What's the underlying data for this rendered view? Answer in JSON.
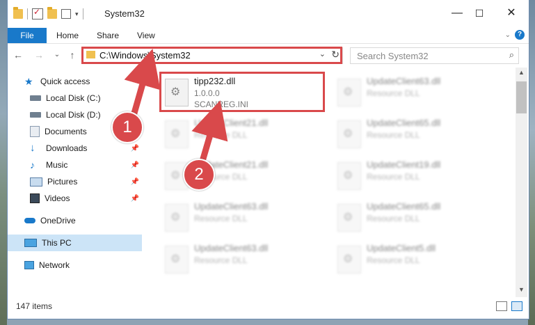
{
  "window": {
    "title": "System32",
    "controls": {
      "minimize": "—",
      "maximize": "☐",
      "close": "✕"
    }
  },
  "ribbon": {
    "tabs": [
      "File",
      "Home",
      "Share",
      "View"
    ],
    "expand_icon": "chevron-down-icon",
    "help_label": "?"
  },
  "nav": {
    "back": "←",
    "forward": "→",
    "dropdown": "⌄",
    "up": "↑",
    "address": "C:\\Windows\\System32",
    "search_placeholder": "Search System32"
  },
  "sidebar": {
    "items": [
      {
        "label": "Quick access",
        "icon": "star-icon",
        "pinned": false
      },
      {
        "label": "Local Disk (C:)",
        "icon": "drive-icon",
        "pinned": false
      },
      {
        "label": "Local Disk (D:)",
        "icon": "drive-icon",
        "pinned": false
      },
      {
        "label": "Documents",
        "icon": "documents-icon",
        "pinned": true
      },
      {
        "label": "Downloads",
        "icon": "download-icon",
        "pinned": true
      },
      {
        "label": "Music",
        "icon": "music-icon",
        "pinned": true
      },
      {
        "label": "Pictures",
        "icon": "pictures-icon",
        "pinned": true
      },
      {
        "label": "Videos",
        "icon": "videos-icon",
        "pinned": true
      },
      {
        "label": "OneDrive",
        "icon": "cloud-icon",
        "pinned": false
      },
      {
        "label": "This PC",
        "icon": "computer-icon",
        "pinned": false,
        "selected": true
      },
      {
        "label": "Network",
        "icon": "network-icon",
        "pinned": false
      }
    ]
  },
  "files": [
    {
      "name": "tipp232.dll",
      "line2": "1.0.0.0",
      "line3": "SCANREG.INI",
      "highlighted": true
    },
    {
      "name": "UpdateClient63.dll",
      "line2": "Resource DLL"
    },
    {
      "name": "UpdateClient21.dll",
      "line2": "Resource DLL"
    },
    {
      "name": "UpdateClient65.dll",
      "line2": "Resource DLL"
    },
    {
      "name": "UpdateClient21.dll",
      "line2": "Resource DLL"
    },
    {
      "name": "UpdateClient19.dll",
      "line2": "Resource DLL"
    },
    {
      "name": "UpdateClient63.dll",
      "line2": "Resource DLL"
    },
    {
      "name": "UpdateClient65.dll",
      "line2": "Resource DLL"
    },
    {
      "name": "UpdateClient63.dll",
      "line2": "Resource DLL"
    },
    {
      "name": "UpdateClient5.dll",
      "line2": "Resource DLL"
    }
  ],
  "status": {
    "items_count": "147 items"
  },
  "annotations": {
    "step1": "1",
    "step2": "2"
  },
  "colors": {
    "accent": "#1979ca",
    "highlight_red": "#d9494b",
    "selected_bg": "#cce4f7"
  }
}
